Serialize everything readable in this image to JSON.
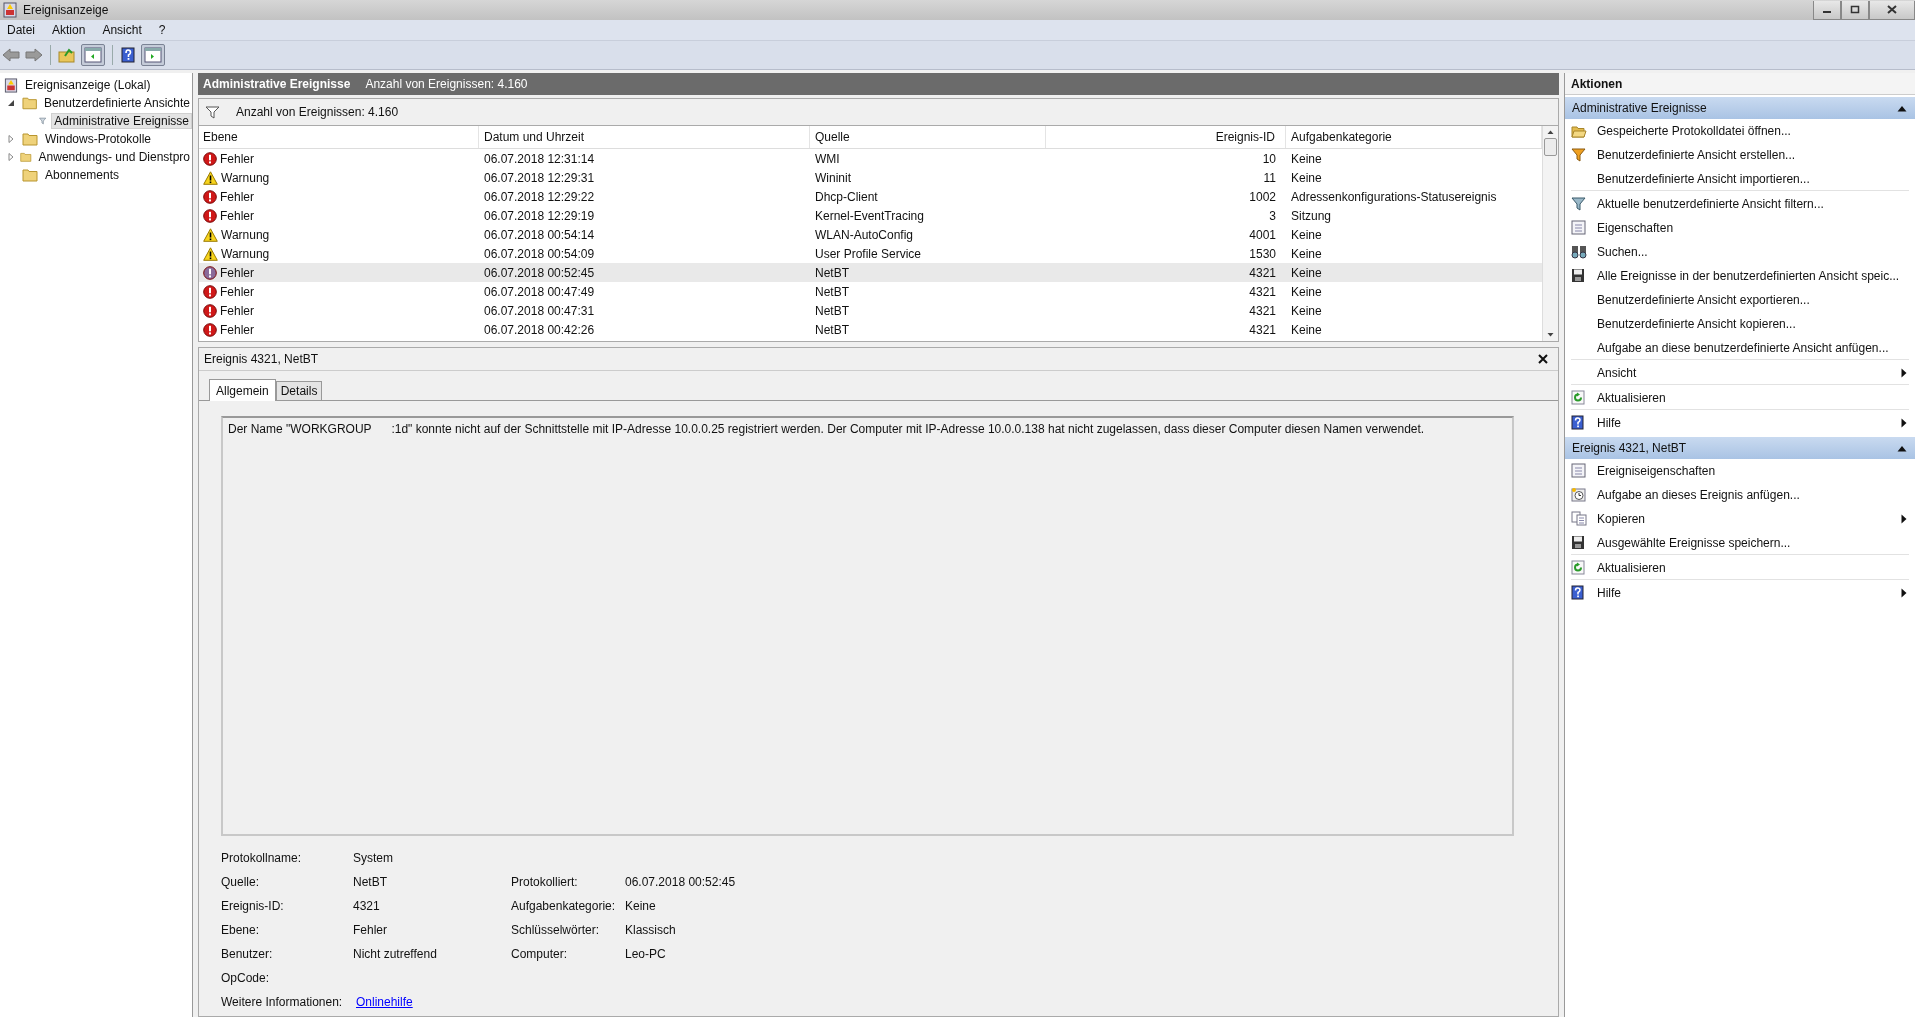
{
  "window": {
    "title": "Ereignisanzeige"
  },
  "menu": [
    "Datei",
    "Aktion",
    "Ansicht",
    "?"
  ],
  "tree": [
    {
      "label": "Ereignisanzeige (Lokal)",
      "selected": false,
      "children": [
        {
          "label": "Benutzerdefinierte Ansichte",
          "selected": false,
          "expanded": true,
          "children": [
            {
              "label": "Administrative Ereignisse",
              "selected": true
            }
          ]
        },
        {
          "label": "Windows-Protokolle",
          "selected": false,
          "expanded": false
        },
        {
          "label": "Anwendungs- und Dienstpro",
          "selected": false,
          "expanded": false
        },
        {
          "label": "Abonnements",
          "selected": false
        }
      ]
    }
  ],
  "view_header": {
    "title": "Administrative Ereignisse",
    "count": "Anzahl von Ereignissen: 4.160"
  },
  "filter_bar": {
    "text": "Anzahl von Ereignissen: 4.160"
  },
  "table": {
    "columns": [
      "Ebene",
      "Datum und Uhrzeit",
      "Quelle",
      "Ereignis-ID",
      "Aufgabenkategorie"
    ],
    "rows": [
      {
        "kind": "error",
        "level": "Fehler",
        "date": "06.07.2018 12:31:14",
        "source": "WMI",
        "id": "10",
        "category": "Keine",
        "selected": false
      },
      {
        "kind": "warning",
        "level": "Warnung",
        "date": "06.07.2018 12:29:31",
        "source": "Wininit",
        "id": "11",
        "category": "Keine",
        "selected": false
      },
      {
        "kind": "error",
        "level": "Fehler",
        "date": "06.07.2018 12:29:22",
        "source": "Dhcp-Client",
        "id": "1002",
        "category": "Adressenkonfigurations-Statusereignis",
        "selected": false
      },
      {
        "kind": "error",
        "level": "Fehler",
        "date": "06.07.2018 12:29:19",
        "source": "Kernel-EventTracing",
        "id": "3",
        "category": "Sitzung",
        "selected": false
      },
      {
        "kind": "warning",
        "level": "Warnung",
        "date": "06.07.2018 00:54:14",
        "source": "WLAN-AutoConfig",
        "id": "4001",
        "category": "Keine",
        "selected": false
      },
      {
        "kind": "warning",
        "level": "Warnung",
        "date": "06.07.2018 00:54:09",
        "source": "User Profile Service",
        "id": "1530",
        "category": "Keine",
        "selected": false
      },
      {
        "kind": "error",
        "level": "Fehler",
        "date": "06.07.2018 00:52:45",
        "source": "NetBT",
        "id": "4321",
        "category": "Keine",
        "selected": true
      },
      {
        "kind": "error",
        "level": "Fehler",
        "date": "06.07.2018 00:47:49",
        "source": "NetBT",
        "id": "4321",
        "category": "Keine",
        "selected": false
      },
      {
        "kind": "error",
        "level": "Fehler",
        "date": "06.07.2018 00:47:31",
        "source": "NetBT",
        "id": "4321",
        "category": "Keine",
        "selected": false
      },
      {
        "kind": "error",
        "level": "Fehler",
        "date": "06.07.2018 00:42:26",
        "source": "NetBT",
        "id": "4321",
        "category": "Keine",
        "selected": false
      }
    ]
  },
  "detail": {
    "title": "Ereignis 4321, NetBT",
    "tabs": [
      {
        "label": "Allgemein",
        "selected": true
      },
      {
        "label": "Details",
        "selected": false
      }
    ],
    "message": "Der Name \"WORKGROUP      :1d\" konnte nicht auf der Schnittstelle mit IP-Adresse 10.0.0.25 registriert werden. Der Computer mit IP-Adresse 10.0.0.138 hat nicht zugelassen, dass dieser Computer diesen Namen verwendet.",
    "properties": [
      {
        "label": "Protokollname:",
        "value": "System"
      },
      {
        "label": "Quelle:",
        "value": "NetBT",
        "label2": "Protokolliert:",
        "value2": "06.07.2018 00:52:45"
      },
      {
        "label": "Ereignis-ID:",
        "value": "4321",
        "label2": "Aufgabenkategorie:",
        "value2": "Keine"
      },
      {
        "label": "Ebene:",
        "value": "Fehler",
        "label2": "Schlüsselwörter:",
        "value2": "Klassisch"
      },
      {
        "label": "Benutzer:",
        "value": "Nicht zutreffend",
        "label2": "Computer:",
        "value2": "Leo-PC"
      },
      {
        "label": "OpCode:"
      },
      {
        "label": "Weitere Informationen:",
        "link": "Onlinehilfe"
      }
    ]
  },
  "actions": {
    "title": "Aktionen",
    "sections": [
      {
        "title": "Administrative Ereignisse",
        "expanded": true,
        "items": [
          {
            "label": "Gespeicherte Protokolldatei öffnen...",
            "kind": "open"
          },
          {
            "label": "Benutzerdefinierte Ansicht erstellen...",
            "kind": "create"
          },
          {
            "label": "Benutzerdefinierte Ansicht importieren...",
            "kind": "plain",
            "divider": true
          },
          {
            "label": "Aktuelle benutzerdefinierte Ansicht filtern...",
            "kind": "filter"
          },
          {
            "label": "Eigenschaften",
            "kind": "properties"
          },
          {
            "label": "Suchen...",
            "kind": "find"
          },
          {
            "label": "Alle Ereignisse in der benutzerdefinierten Ansicht speic...",
            "kind": "save"
          },
          {
            "label": "Benutzerdefinierte Ansicht exportieren...",
            "kind": "plain"
          },
          {
            "label": "Benutzerdefinierte Ansicht kopieren...",
            "kind": "plain"
          },
          {
            "label": "Aufgabe an diese benutzerdefinierte Ansicht anfügen...",
            "kind": "plain",
            "divider": true
          },
          {
            "label": "Ansicht",
            "kind": "plain",
            "submenu": true,
            "divider": true
          },
          {
            "label": "Aktualisieren",
            "kind": "refresh",
            "divider": true
          },
          {
            "label": "Hilfe",
            "kind": "help",
            "submenu": true
          }
        ]
      },
      {
        "title": "Ereignis 4321, NetBT",
        "expanded": true,
        "items": [
          {
            "label": "Ereigniseigenschaften",
            "kind": "properties"
          },
          {
            "label": "Aufgabe an dieses Ereignis anfügen...",
            "kind": "task"
          },
          {
            "label": "Kopieren",
            "kind": "copy",
            "submenu": true
          },
          {
            "label": "Ausgewählte Ereignisse speichern...",
            "kind": "save",
            "divider": true
          },
          {
            "label": "Aktualisieren",
            "kind": "refresh",
            "divider": true
          },
          {
            "label": "Hilfe",
            "kind": "help",
            "submenu": true
          }
        ]
      }
    ]
  }
}
